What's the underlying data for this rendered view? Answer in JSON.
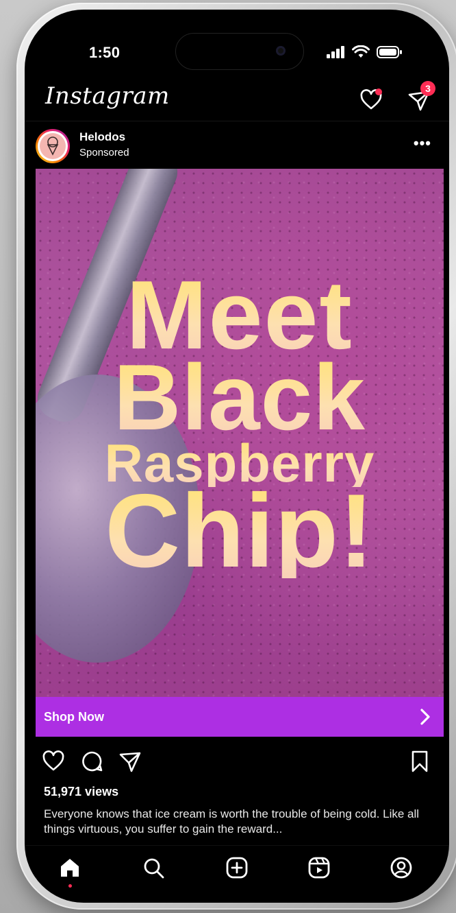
{
  "status_bar": {
    "time": "1:50"
  },
  "header": {
    "logo": "Instagram",
    "activity_notification_dot": true,
    "messages_badge": "3"
  },
  "post": {
    "username": "Helodos",
    "label": "Sponsored",
    "headline": {
      "line1": "Meet",
      "line2": "Black",
      "line3": "Raspberry",
      "line4": "Chip!"
    },
    "cta": {
      "label": "Shop Now",
      "color": "#ad2fe3"
    },
    "views": "51,971 views",
    "caption": "Everyone knows that ice cream is worth the trouble of being cold. Like all things virtuous, you suffer to gain the reward..."
  },
  "tab_bar": {
    "items": [
      "home-icon",
      "search-icon",
      "create-icon",
      "reels-icon",
      "profile-icon"
    ],
    "active": "home-icon"
  },
  "colors": {
    "accent": "#ff2d55",
    "headline_yellow": "#ffe27a",
    "headline_peach": "#f9d1b8",
    "ice_cream": "#b24b99"
  }
}
